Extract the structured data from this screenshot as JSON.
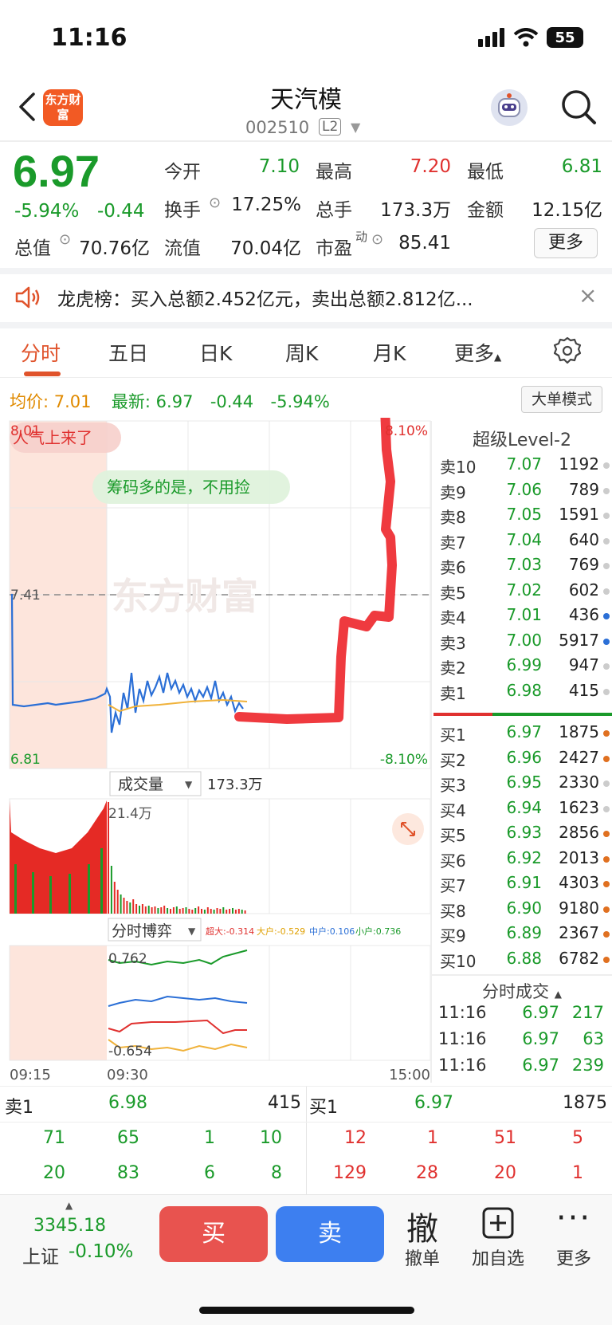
{
  "status": {
    "time": "11:16",
    "battery": "55"
  },
  "header": {
    "logo": "东方财富",
    "name": "天汽模",
    "code": "002510",
    "badge": "L2"
  },
  "quote": {
    "price": "6.97",
    "pct": "-5.94%",
    "chg": "-0.44",
    "open_label": "今开",
    "open": "7.10",
    "high_label": "最高",
    "high": "7.20",
    "low_label": "最低",
    "low": "6.81",
    "turnover_label": "换手",
    "turnover": "17.25%",
    "volume_label": "总手",
    "volume": "173.3万",
    "amount_label": "金额",
    "amount": "12.15亿",
    "mktcap_label": "总值",
    "mktcap": "70.76亿",
    "float_label": "流值",
    "float": "70.04亿",
    "pe_label": "市盈",
    "pe_sup": "动",
    "pe": "85.41",
    "more": "更多"
  },
  "notice": {
    "text": "龙虎榜：买入总额2.452亿元，卖出总额2.812亿..."
  },
  "tabs": {
    "t1": "分时",
    "t2": "五日",
    "t3": "日K",
    "t4": "周K",
    "t5": "月K",
    "t6": "更多"
  },
  "infoline": {
    "avg_label": "均价:",
    "avg": "7.01",
    "latest_label": "最新:",
    "latest": "6.97",
    "chg": "-0.44",
    "pct": "-5.94%",
    "big_order": "大单模式"
  },
  "chart": {
    "top_price": "8.01",
    "bottom_price": "6.81",
    "ref_price": "7.41",
    "top_pct": "8.10%",
    "bottom_pct": "-8.10%",
    "bubble1": "人气上来了",
    "bubble2": "筹码多的是，不用捡",
    "watermark": "东方财富",
    "vol_label": "成交量",
    "vol_total": "173.3万",
    "vol_max": "21.4万",
    "game_label": "分时博弈",
    "game_legend": {
      "super": "超大:-0.314",
      "big": "大户:-0.529",
      "mid": "中户:0.106",
      "small": "小户:0.736"
    },
    "game_top": "0.762",
    "game_bottom": "-0.654",
    "time_start": "09:15",
    "time_open": "09:30",
    "time_end": "15:00"
  },
  "book": {
    "title": "超级Level-2",
    "asks": [
      {
        "label": "卖10",
        "price": "7.07",
        "vol": "1192",
        "dot": "#cccccc"
      },
      {
        "label": "卖9",
        "price": "7.06",
        "vol": "789",
        "dot": "#cccccc"
      },
      {
        "label": "卖8",
        "price": "7.05",
        "vol": "1591",
        "dot": "#cccccc"
      },
      {
        "label": "卖7",
        "price": "7.04",
        "vol": "640",
        "dot": "#cccccc"
      },
      {
        "label": "卖6",
        "price": "7.03",
        "vol": "769",
        "dot": "#cccccc"
      },
      {
        "label": "卖5",
        "price": "7.02",
        "vol": "602",
        "dot": "#cccccc"
      },
      {
        "label": "卖4",
        "price": "7.01",
        "vol": "436",
        "dot": "#2b6fd6"
      },
      {
        "label": "卖3",
        "price": "7.00",
        "vol": "5917",
        "dot": "#2b6fd6"
      },
      {
        "label": "卖2",
        "price": "6.99",
        "vol": "947",
        "dot": "#cccccc"
      },
      {
        "label": "卖1",
        "price": "6.98",
        "vol": "415",
        "dot": "#cccccc"
      }
    ],
    "bids": [
      {
        "label": "买1",
        "price": "6.97",
        "vol": "1875",
        "dot": "#e07020"
      },
      {
        "label": "买2",
        "price": "6.96",
        "vol": "2427",
        "dot": "#e07020"
      },
      {
        "label": "买3",
        "price": "6.95",
        "vol": "2330",
        "dot": "#cccccc"
      },
      {
        "label": "买4",
        "price": "6.94",
        "vol": "1623",
        "dot": "#cccccc"
      },
      {
        "label": "买5",
        "price": "6.93",
        "vol": "2856",
        "dot": "#e07020"
      },
      {
        "label": "买6",
        "price": "6.92",
        "vol": "2013",
        "dot": "#e07020"
      },
      {
        "label": "买7",
        "price": "6.91",
        "vol": "4303",
        "dot": "#e07020"
      },
      {
        "label": "买8",
        "price": "6.90",
        "vol": "9180",
        "dot": "#e07020"
      },
      {
        "label": "买9",
        "price": "6.89",
        "vol": "2367",
        "dot": "#e07020"
      },
      {
        "label": "买10",
        "price": "6.88",
        "vol": "6782",
        "dot": "#e07020"
      }
    ],
    "ticks_title": "分时成交",
    "ticks": [
      {
        "time": "11:16",
        "price": "6.97",
        "vol": "217"
      },
      {
        "time": "11:16",
        "price": "6.97",
        "vol": "63"
      },
      {
        "time": "11:16",
        "price": "6.97",
        "vol": "239"
      }
    ]
  },
  "level1": {
    "ask_label": "卖1",
    "ask_price": "6.98",
    "ask_vol": "415",
    "bid_label": "买1",
    "bid_price": "6.97",
    "bid_vol": "1875",
    "ask_row1": [
      "71",
      "65",
      "1",
      "10"
    ],
    "ask_row2": [
      "20",
      "83",
      "6",
      "8"
    ],
    "bid_row1": [
      "12",
      "1",
      "51",
      "5"
    ],
    "bid_row2": [
      "129",
      "28",
      "20",
      "1"
    ]
  },
  "bottom": {
    "index_val": "3345.18",
    "index_name": "上证",
    "index_pct": "-0.10%",
    "buy": "买",
    "sell": "卖",
    "cancel_icon": "撤",
    "cancel": "撤单",
    "add": "加自选",
    "more": "更多"
  }
}
